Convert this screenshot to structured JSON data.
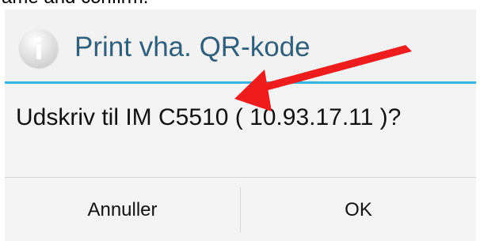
{
  "caption": {
    "text": "ame and confirm."
  },
  "dialog": {
    "title": "Print vha. QR-kode",
    "title_icon": "info-icon",
    "message": "Udskriv til IM C5510 ( 10.93.17.11 )?",
    "buttons": {
      "cancel_label": "Annuller",
      "ok_label": "OK"
    }
  },
  "colors": {
    "title_text": "#2f5f7d",
    "divider_accent": "#33b5e5",
    "annotation_arrow": "#ee1c1c",
    "dialog_background": "#f4f4f4"
  }
}
